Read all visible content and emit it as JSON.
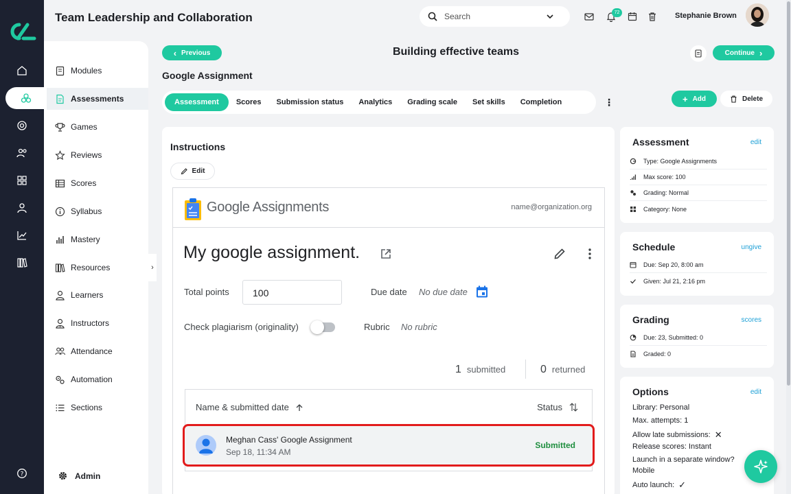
{
  "header": {
    "app_title": "Team Leadership and Collaboration",
    "search_placeholder": "Search",
    "notification_count": "72",
    "user_name": "Stephanie Brown"
  },
  "sidebar": {
    "items": [
      {
        "label": "Modules",
        "icon": "book-icon"
      },
      {
        "label": "Assessments",
        "icon": "document-icon",
        "active": true
      },
      {
        "label": "Games",
        "icon": "trophy-icon"
      },
      {
        "label": "Reviews",
        "icon": "star-icon"
      },
      {
        "label": "Scores",
        "icon": "table-icon"
      },
      {
        "label": "Syllabus",
        "icon": "info-icon"
      },
      {
        "label": "Mastery",
        "icon": "bar-chart-icon"
      },
      {
        "label": "Resources",
        "icon": "library-icon"
      },
      {
        "label": "Learners",
        "icon": "person-icon"
      },
      {
        "label": "Instructors",
        "icon": "instructor-icon"
      },
      {
        "label": "Attendance",
        "icon": "group-icon"
      },
      {
        "label": "Automation",
        "icon": "gears-icon"
      },
      {
        "label": "Sections",
        "icon": "list-icon"
      }
    ],
    "admin_label": "Admin"
  },
  "page": {
    "prev_label": "Previous",
    "title": "Building effective teams",
    "continue_label": "Continue",
    "subtitle": "Google Assignment",
    "tabs": [
      "Assessment",
      "Scores",
      "Submission status",
      "Analytics",
      "Grading scale",
      "Set skills",
      "Completion"
    ],
    "add_label": "Add",
    "delete_label": "Delete"
  },
  "instructions": {
    "heading": "Instructions",
    "edit_label": "Edit"
  },
  "google": {
    "brand_bold": "Google",
    "brand_rest": " Assignments",
    "email": "name@organization.org",
    "assignment_title": "My google assignment.",
    "total_points_label": "Total points",
    "total_points_value": "100",
    "due_date_label": "Due date",
    "due_date_value": "No due date",
    "plagiarism_label": "Check plagiarism (originality)",
    "rubric_label": "Rubric",
    "rubric_value": "No rubric",
    "submitted_count": "1",
    "submitted_label": "submitted",
    "returned_count": "0",
    "returned_label": "returned",
    "col_name": "Name & submitted date",
    "col_status": "Status",
    "row": {
      "name": "Meghan Cass' Google Assignment",
      "date": "Sep 18, 11:34 AM",
      "status": "Submitted"
    }
  },
  "assessment_card": {
    "heading": "Assessment",
    "link": "edit",
    "lines": [
      "Type: Google Assignments",
      "Max score: 100",
      "Grading: Normal",
      "Category: None"
    ]
  },
  "schedule_card": {
    "heading": "Schedule",
    "link": "ungive",
    "lines": [
      "Due: Sep 20, 8:00 am",
      "Given: Jul 21, 2:16 pm"
    ]
  },
  "grading_card": {
    "heading": "Grading",
    "link": "scores",
    "lines": [
      "Due: 23, Submitted: 0",
      "Graded: 0"
    ]
  },
  "options_card": {
    "heading": "Options",
    "link": "edit",
    "lines": [
      "Library: Personal",
      "Max. attempts: 1",
      "Allow late submissions:",
      "Release scores: Instant",
      "Launch in a separate window?",
      "Mobile",
      "Auto launch:"
    ]
  },
  "colors": {
    "accent": "#1fc9a0",
    "rail": "#1c2130",
    "highlight": "#e21b1b",
    "status_green": "#1e8e3e",
    "link": "#1b9fd6"
  }
}
